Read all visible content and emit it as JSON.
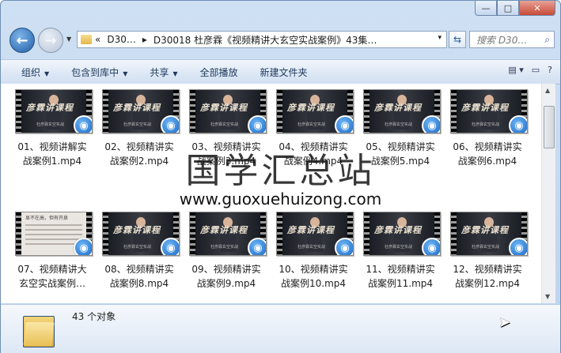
{
  "window": {
    "minimize": "—",
    "maximize": "□",
    "close": "✕"
  },
  "nav": {
    "back_icon": "arrow-left-icon",
    "forward_icon": "arrow-right-icon"
  },
  "address": {
    "prefix": "«",
    "crumb1": "D30…",
    "sep": "▸",
    "crumb2": "D30018 杜彦霖《视频精讲大玄空实战案例》43集…",
    "dropdown": "▾"
  },
  "search": {
    "placeholder": "搜索 D30…"
  },
  "toolbar": {
    "organize": "组织",
    "include": "包含到库中",
    "share": "共享",
    "play_all": "全部播放",
    "new_folder": "新建文件夹"
  },
  "files": [
    {
      "line1": "01、视频讲解实",
      "line2": "战案例1.mp4",
      "thumb": "lecture"
    },
    {
      "line1": "02、视频精讲实",
      "line2": "战案例2.mp4",
      "thumb": "lecture"
    },
    {
      "line1": "03、视频精讲实",
      "line2": "战案例3.mp4",
      "thumb": "lecture"
    },
    {
      "line1": "04、视频精讲实",
      "line2": "战案例4.mp4",
      "thumb": "lecture"
    },
    {
      "line1": "05、视频精讲实",
      "line2": "战案例5.mp4",
      "thumb": "lecture"
    },
    {
      "line1": "06、视频精讲实",
      "line2": "战案例6.mp4",
      "thumb": "lecture"
    },
    {
      "line1": "07、视频精讲大",
      "line2": "玄空实战案例…",
      "thumb": "document"
    },
    {
      "line1": "08、视频精讲实",
      "line2": "战案例8.mp4",
      "thumb": "lecture"
    },
    {
      "line1": "09、视频精讲实",
      "line2": "战案例9.mp4",
      "thumb": "lecture"
    },
    {
      "line1": "10、视频精讲实",
      "line2": "战案例10.mp4",
      "thumb": "lecture"
    },
    {
      "line1": "11、视频精讲实",
      "line2": "战案例11.mp4",
      "thumb": "lecture"
    },
    {
      "line1": "12、视频精讲实",
      "line2": "战案例12.mp4",
      "thumb": "lecture"
    }
  ],
  "thumb_text": {
    "calligraphy": "彦霖讲课程",
    "doc_title": "显不在高，但有开泉",
    "sub": "杜彦霖玄空实战"
  },
  "watermark": {
    "text": "国学汇总站",
    "url": "www.guoxuehuizong.com"
  },
  "status": {
    "count": "43 个对象"
  },
  "colors": {
    "accent": "#1566c7",
    "toolbar_text": "#1e395b"
  }
}
